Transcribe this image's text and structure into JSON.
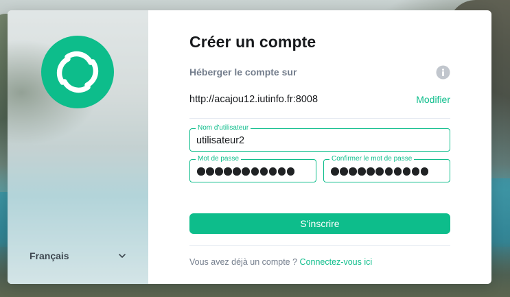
{
  "page": {
    "language": "Français"
  },
  "register": {
    "title": "Créer un compte",
    "host_label": "Héberger le compte sur",
    "server_url": "http://acajou12.iutinfo.fr:8008",
    "modify_label": "Modifier",
    "username_label": "Nom d'utilisateur",
    "username_value": "utilisateur2",
    "password_label": "Mot de passe",
    "password_dots": 11,
    "confirm_label": "Confirmer le mot de passe",
    "confirm_dots": 11,
    "submit_label": "S'inscrire",
    "login_prompt": "Vous avez déjà un compte ?",
    "login_link": "Connectez-vous ici"
  },
  "icons": {
    "logo": "element-logo-icon",
    "language_chevron": "chevron-down-icon",
    "info": "info-icon"
  },
  "colors": {
    "accent": "#0dbd8b",
    "text_primary": "#17191c",
    "text_secondary": "#737d8c",
    "divider": "#e3e8f0",
    "card_background": "#ffffff"
  }
}
